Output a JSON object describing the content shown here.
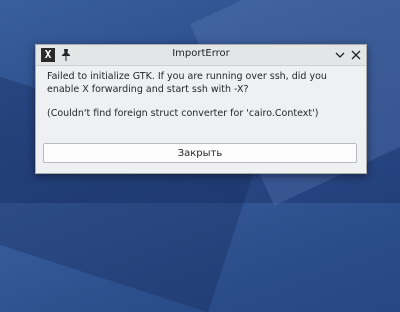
{
  "window": {
    "title": "ImportError"
  },
  "message": {
    "line1": "Failed to initialize GTK. If you are running over ssh, did you enable X forwarding and start ssh with -X?",
    "line2": "(Couldn't find foreign struct converter for 'cairo.Context')"
  },
  "buttons": {
    "close_label": "Закрыть"
  },
  "icons": {
    "app": "x11-icon",
    "pin": "pin-icon",
    "minimize": "chevron-down-icon",
    "close": "close-icon"
  }
}
